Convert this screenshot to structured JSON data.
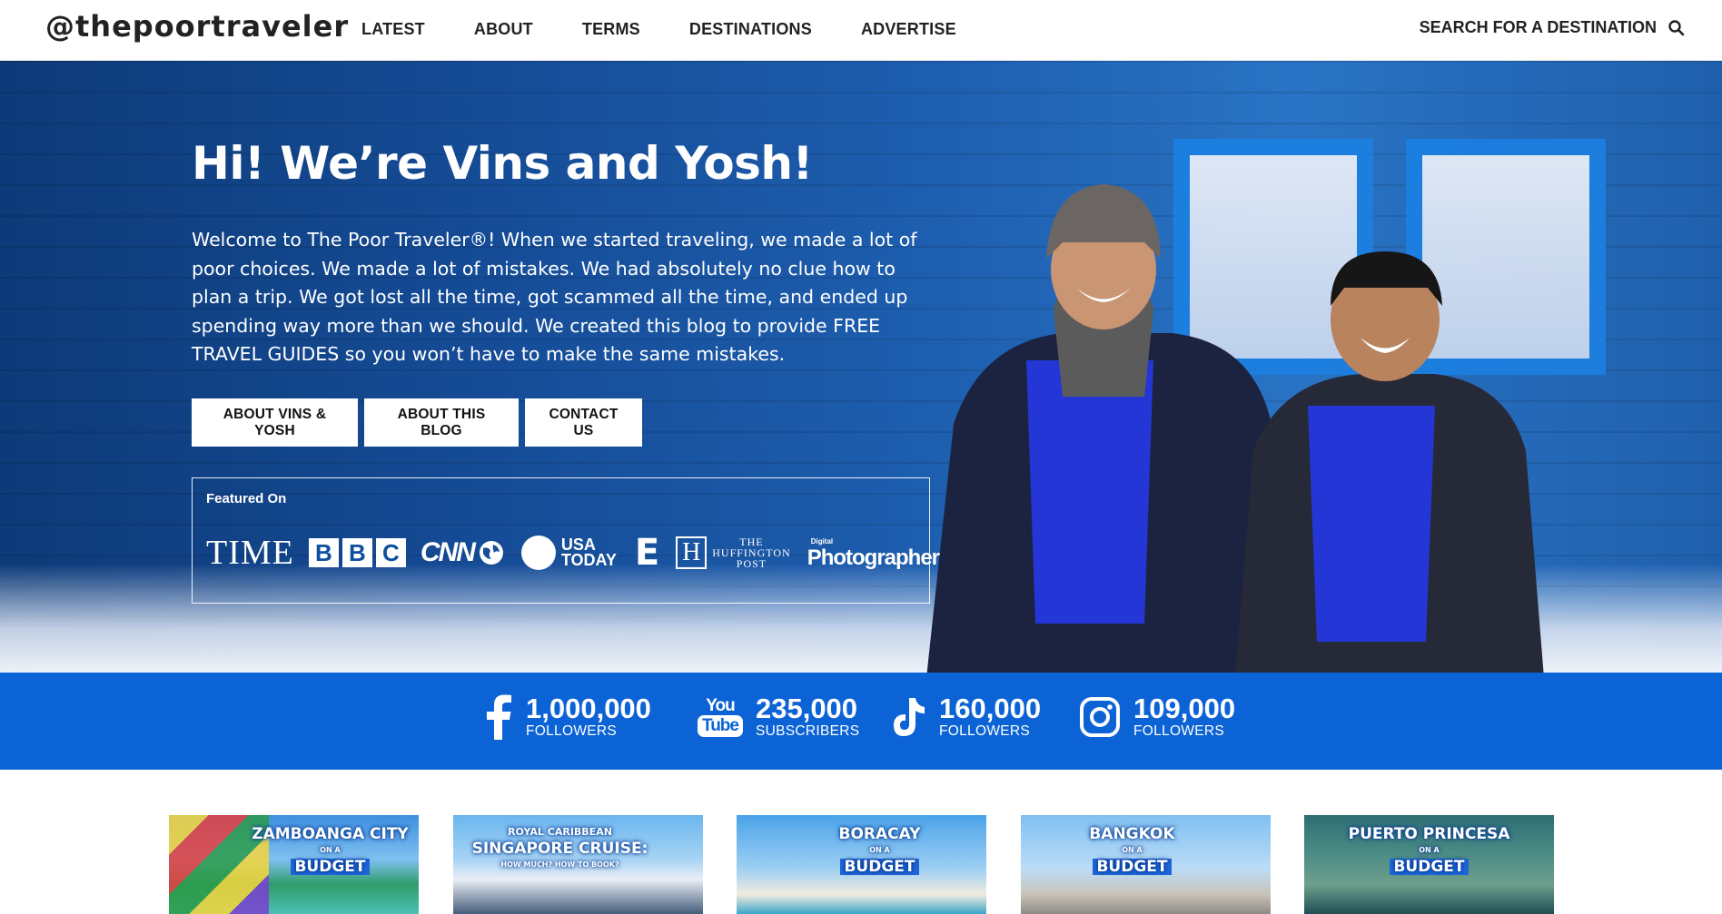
{
  "header": {
    "logo": "@thepoortraveler",
    "nav": [
      "LATEST",
      "ABOUT",
      "TERMS",
      "DESTINATIONS",
      "ADVERTISE"
    ],
    "search_label": "SEARCH FOR A DESTINATION",
    "search_icon": "search-icon"
  },
  "hero": {
    "title": "Hi! We’re Vins and Yosh!",
    "intro": "Welcome to The Poor Traveler®! When we started traveling, we made a lot of poor choices. We made a lot of mistakes. We had absolutely no clue how to plan a trip. We got lost all the time, got scammed all the time, and ended up spending way more than we should. We created this blog to provide FREE TRAVEL GUIDES so you won’t have to make the same mistakes.",
    "buttons": [
      "ABOUT VINS & YOSH",
      "ABOUT THIS BLOG",
      "CONTACT US"
    ],
    "featured_label": "Featured On",
    "featured_logos": {
      "time": "TIME",
      "bbc": [
        "B",
        "B",
        "C"
      ],
      "cnn": "CNN",
      "usa_today": [
        "USA",
        "TODAY"
      ],
      "e": "E",
      "huffpost": [
        "THE",
        "HUFFINGTON",
        "POST"
      ],
      "huffpost_mark": "H",
      "digital_photographer": [
        "Digital",
        "Photographer"
      ]
    }
  },
  "social": [
    {
      "icon": "facebook-icon",
      "count": "1,000,000",
      "label": "FOLLOWERS"
    },
    {
      "icon": "youtube-icon",
      "count": "235,000",
      "label": "SUBSCRIBERS",
      "icon_text": [
        "You",
        "Tube"
      ]
    },
    {
      "icon": "tiktok-icon",
      "count": "160,000",
      "label": "FOLLOWERS"
    },
    {
      "icon": "instagram-icon",
      "count": "109,000",
      "label": "FOLLOWERS"
    }
  ],
  "cards": [
    {
      "title": "ZAMBOANGA CITY",
      "sub": "BUDGET",
      "on_a": "ON A"
    },
    {
      "title": "SINGAPORE CRUISE:",
      "pre": "ROYAL CARIBBEAN",
      "sub": "HOW MUCH? HOW TO BOOK?"
    },
    {
      "title": "BORACAY",
      "sub": "BUDGET",
      "on_a": "ON A"
    },
    {
      "title": "BANGKOK",
      "sub": "BUDGET",
      "on_a": "ON A"
    },
    {
      "title": "PUERTO PRINCESA",
      "sub": "BUDGET",
      "on_a": "ON A"
    }
  ],
  "colors": {
    "brand_blue": "#0b63d6",
    "hero_blue": "#164d98"
  }
}
